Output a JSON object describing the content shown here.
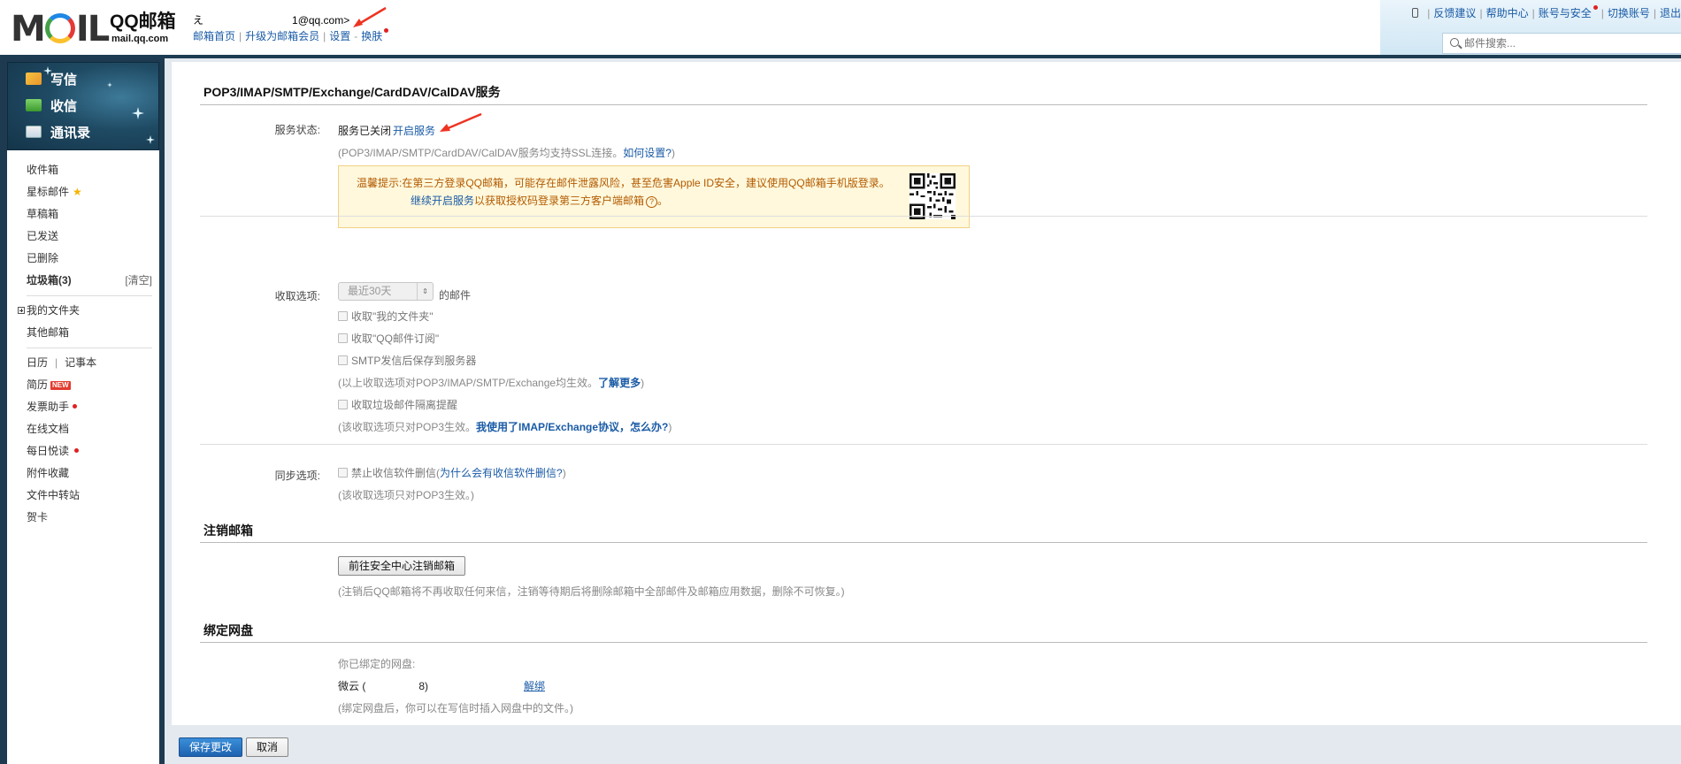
{
  "header": {
    "brand": "QQ邮箱",
    "brand_url": "mail.qq.com",
    "user_initial": "え",
    "user_email_suffix": "1@qq.com>",
    "links": [
      {
        "label": "邮箱首页"
      },
      {
        "label": "升级为邮箱会员"
      },
      {
        "label": "设置"
      },
      {
        "label": "换肤"
      }
    ],
    "right_links": [
      {
        "label": "反馈建议"
      },
      {
        "label": "帮助中心"
      },
      {
        "label": "账号与安全"
      },
      {
        "label": "切换账号"
      },
      {
        "label": "退出"
      }
    ],
    "search_placeholder": "邮件搜索..."
  },
  "sidebar": {
    "actions": [
      {
        "label": "写信"
      },
      {
        "label": "收信"
      },
      {
        "label": "通讯录"
      }
    ],
    "folders": [
      {
        "label": "收件箱"
      },
      {
        "label": "星标邮件"
      },
      {
        "label": "草稿箱"
      },
      {
        "label": "已发送"
      },
      {
        "label": "已删除"
      },
      {
        "label": "垃圾箱(3)"
      }
    ],
    "clear_label": "[清空]",
    "my_folders": "我的文件夹",
    "other_mail": "其他邮箱",
    "calendar": "日历",
    "notes": "记事本",
    "apps": [
      {
        "label": "简历"
      },
      {
        "label": "发票助手"
      },
      {
        "label": "在线文档"
      },
      {
        "label": "每日悦读"
      },
      {
        "label": "附件收藏"
      },
      {
        "label": "文件中转站"
      },
      {
        "label": "贺卡"
      }
    ],
    "new_badge": "NEW"
  },
  "main": {
    "section1_title": "POP3/IMAP/SMTP/Exchange/CardDAV/CalDAV服务",
    "service_status_label": "服务状态:",
    "service_status_value": "服务已关闭",
    "enable_service": "开启服务",
    "ssl_note": "(POP3/IMAP/SMTP/CardDAV/CalDAV服务均支持SSL连接。",
    "how_to_set": "如何设置?",
    "ssl_note_end": ")",
    "tip_label": "温馨提示:",
    "tip_text": "在第三方登录QQ邮箱，可能存在邮件泄露风险，甚至危害Apple ID安全，建议使用QQ邮箱手机版登录。",
    "tip_link": "继续开启服务",
    "tip_text2": "以获取授权码登录第三方客户端邮箱",
    "tip_qm": "?",
    "tip_end": "。",
    "receive_label": "收取选项:",
    "receive_select": "最近30天",
    "receive_suffix": "的邮件",
    "cb1": "收取\"我的文件夹\"",
    "cb2": "收取\"QQ邮件订阅\"",
    "cb3": "SMTP发信后保存到服务器",
    "receive_note": "(以上收取选项对POP3/IMAP/SMTP/Exchange均生效。",
    "learn_more": "了解更多",
    "receive_note_end": ")",
    "cb4": "收取垃圾邮件隔离提醒",
    "pop3_note": "(该收取选项只对POP3生效。",
    "imap_link": "我使用了IMAP/Exchange协议，怎么办?",
    "pop3_note_end": ")",
    "sync_label": "同步选项:",
    "cb5": "禁止收信软件删信",
    "why_link_prefix": "(",
    "why_link": "为什么会有收信软件删信?",
    "why_link_end": ")",
    "sync_note": "(该收取选项只对POP3生效。)",
    "section2_title": "注销邮箱",
    "cancel_button": "前往安全中心注销邮箱",
    "cancel_note": "(注销后QQ邮箱将不再收取任何来信，注销等待期后将删除邮箱中全部邮件及邮箱应用数据，删除不可恢复。)",
    "section3_title": "绑定网盘",
    "bound_label": "你已绑定的网盘:",
    "weiyun_prefix": "微云 (",
    "weiyun_suffix": "8)",
    "unbind": "解绑",
    "bind_note": "(绑定网盘后，你可以在写信时插入网盘中的文件。)",
    "save_button": "保存更改",
    "cancel_btn": "取消"
  }
}
